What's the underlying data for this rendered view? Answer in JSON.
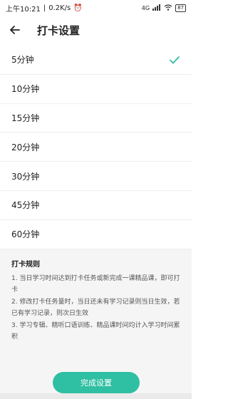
{
  "status_bar": {
    "time": "上午10:21",
    "speed": "0.2K/s",
    "signal": "4G",
    "battery": "87"
  },
  "header": {
    "title": "打卡设置"
  },
  "options": [
    {
      "label": "5分钟",
      "selected": true
    },
    {
      "label": "10分钟",
      "selected": false
    },
    {
      "label": "15分钟",
      "selected": false
    },
    {
      "label": "20分钟",
      "selected": false
    },
    {
      "label": "30分钟",
      "selected": false
    },
    {
      "label": "45分钟",
      "selected": false
    },
    {
      "label": "60分钟",
      "selected": false
    }
  ],
  "rules": {
    "title": "打卡规则",
    "items": [
      "1. 当日学习时间达到打卡任务或新完成一课精品课，即可打卡",
      "2. 修改打卡任务量时，当日还未有学习记录则当日生效，若已有学习记录，则次日生效",
      "3. 学习专辑、精听口语训练、精品课时间均计入学习时间累积"
    ]
  },
  "done_button": {
    "label": "完成设置"
  },
  "colors": {
    "accent": "#2fbfa2",
    "rules_bg": "#f5f5f5"
  }
}
